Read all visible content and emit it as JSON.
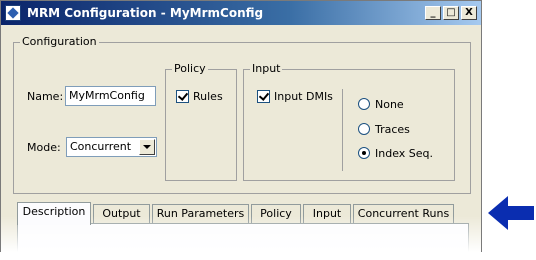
{
  "window": {
    "title": "MRM Configuration - MyMrmConfig",
    "controls": {
      "minimize": "_",
      "maximize": "□",
      "close": "X"
    }
  },
  "configuration": {
    "group_label": "Configuration",
    "name_label": "Name:",
    "name_value": "MyMrmConfig",
    "mode_label": "Mode:",
    "mode_value": "Concurrent"
  },
  "policy": {
    "group_label": "Policy",
    "rules_label": "Rules",
    "rules_checked": true
  },
  "input": {
    "group_label": "Input",
    "input_dmis_label": "Input DMIs",
    "input_dmis_checked": true,
    "options": [
      {
        "label": "None",
        "selected": false
      },
      {
        "label": "Traces",
        "selected": false
      },
      {
        "label": "Index Seq.",
        "selected": true
      }
    ]
  },
  "tabs": [
    {
      "label": "Description",
      "active": true
    },
    {
      "label": "Output",
      "active": false
    },
    {
      "label": "Run Parameters",
      "active": false
    },
    {
      "label": "Policy",
      "active": false
    },
    {
      "label": "Input",
      "active": false
    },
    {
      "label": "Concurrent Runs",
      "active": false
    }
  ],
  "annotation": {
    "icon": "arrow-left-icon",
    "color": "#0a2db0"
  },
  "colors": {
    "titlebar_start": "#0a246a",
    "titlebar_end": "#a6caf0",
    "window_bg": "#ece9d8"
  }
}
